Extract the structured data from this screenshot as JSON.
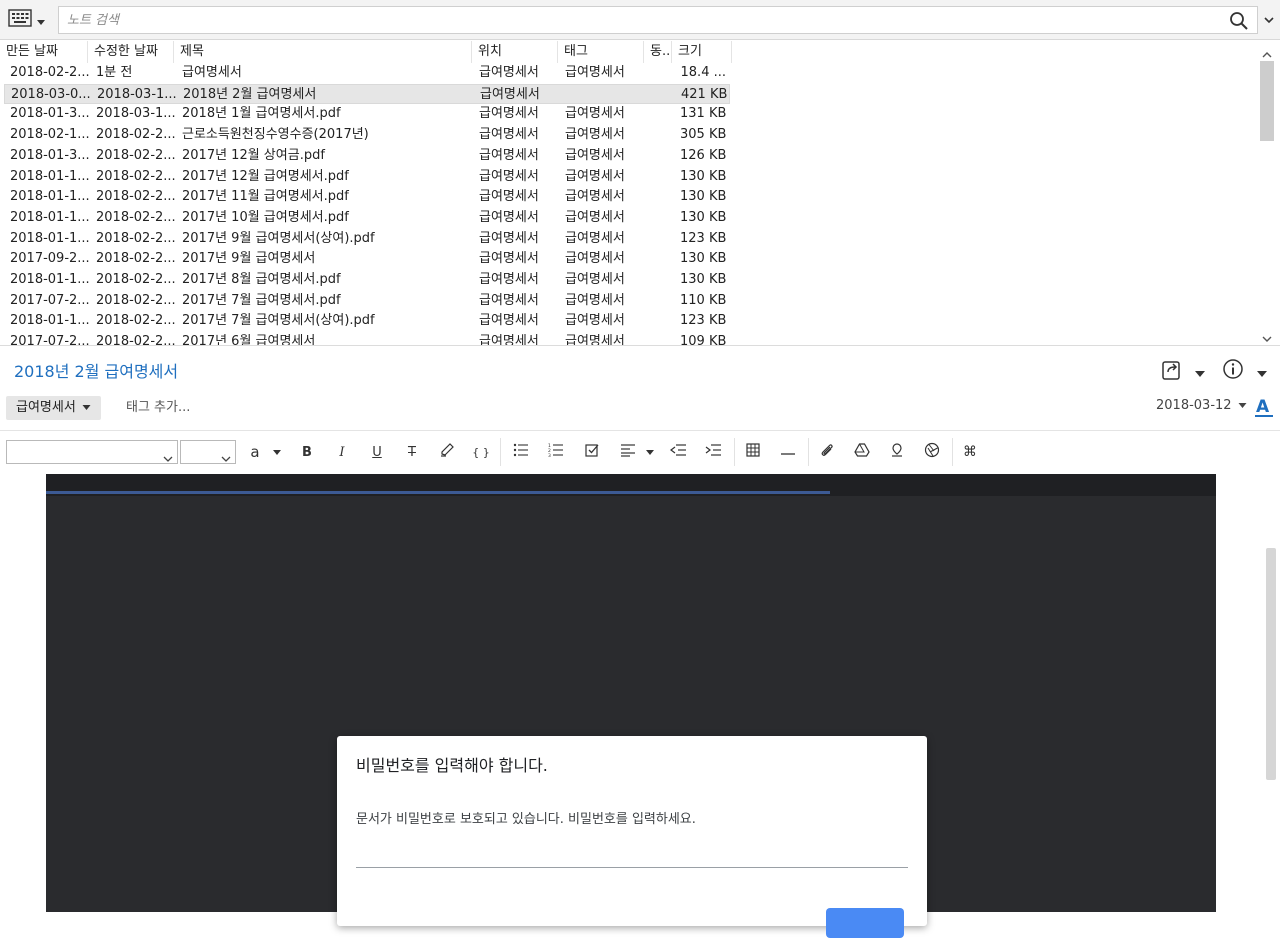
{
  "search": {
    "placeholder": "노트 검색"
  },
  "icons": {
    "view_switch": "keyboard-grid-icon",
    "search": "search-icon",
    "search_options": "chevron-down-icon",
    "share": "share-icon",
    "info": "info-icon",
    "font_style": "font-color-icon"
  },
  "list": {
    "columns": [
      "만든 날짜",
      "수정한 날짜",
      "제목",
      "위치",
      "태그",
      "동...",
      "크기"
    ],
    "rows": [
      {
        "created": "2018-02-2...",
        "modified": "1분 전",
        "title": "급여명세서",
        "location": "급여명세서",
        "tag": "급여명세서",
        "sync": "",
        "size": "18.4 ..."
      },
      {
        "created": "2018-03-0...",
        "modified": "2018-03-1...",
        "title": "2018년 2월 급여명세서",
        "location": "급여명세서",
        "tag": "",
        "sync": "",
        "size": "421 KB"
      },
      {
        "created": "2018-01-3...",
        "modified": "2018-03-1...",
        "title": "2018년 1월 급여명세서.pdf",
        "location": "급여명세서",
        "tag": "급여명세서",
        "sync": "",
        "size": "131 KB"
      },
      {
        "created": "2018-02-1...",
        "modified": "2018-02-2...",
        "title": "근로소득원천징수영수증(2017년)",
        "location": "급여명세서",
        "tag": "급여명세서",
        "sync": "",
        "size": "305 KB"
      },
      {
        "created": "2018-01-3...",
        "modified": "2018-02-2...",
        "title": "2017년 12월 상여금.pdf",
        "location": "급여명세서",
        "tag": "급여명세서",
        "sync": "",
        "size": "126 KB"
      },
      {
        "created": "2018-01-1...",
        "modified": "2018-02-2...",
        "title": "2017년 12월 급여명세서.pdf",
        "location": "급여명세서",
        "tag": "급여명세서",
        "sync": "",
        "size": "130 KB"
      },
      {
        "created": "2018-01-1...",
        "modified": "2018-02-2...",
        "title": "2017년 11월 급여명세서.pdf",
        "location": "급여명세서",
        "tag": "급여명세서",
        "sync": "",
        "size": "130 KB"
      },
      {
        "created": "2018-01-1...",
        "modified": "2018-02-2...",
        "title": "2017년 10월 급여명세서.pdf",
        "location": "급여명세서",
        "tag": "급여명세서",
        "sync": "",
        "size": "130 KB"
      },
      {
        "created": "2018-01-1...",
        "modified": "2018-02-2...",
        "title": "2017년 9월 급여명세서(상여).pdf",
        "location": "급여명세서",
        "tag": "급여명세서",
        "sync": "",
        "size": "123 KB"
      },
      {
        "created": "2017-09-2...",
        "modified": "2018-02-2...",
        "title": "2017년 9월 급여명세서",
        "location": "급여명세서",
        "tag": "급여명세서",
        "sync": "",
        "size": "130 KB"
      },
      {
        "created": "2018-01-1...",
        "modified": "2018-02-2...",
        "title": "2017년 8월 급여명세서.pdf",
        "location": "급여명세서",
        "tag": "급여명세서",
        "sync": "",
        "size": "130 KB"
      },
      {
        "created": "2017-07-2...",
        "modified": "2018-02-2...",
        "title": "2017년 7월 급여명세서.pdf",
        "location": "급여명세서",
        "tag": "급여명세서",
        "sync": "",
        "size": "110 KB"
      },
      {
        "created": "2018-01-1...",
        "modified": "2018-02-2...",
        "title": "2017년 7월 급여명세서(상여).pdf",
        "location": "급여명세서",
        "tag": "급여명세서",
        "sync": "",
        "size": "123 KB"
      },
      {
        "created": "2017-07-2...",
        "modified": "2018-02-2...",
        "title": "2017년 6월 급여명세서",
        "location": "급여명세서",
        "tag": "급여명세서",
        "sync": "",
        "size": "109 KB"
      }
    ],
    "selected_index": 1
  },
  "note": {
    "title": "2018년 2월 급여명세서",
    "notebook": "급여명세서",
    "tag_placeholder": "태그 추가...",
    "date": "2018-03-12"
  },
  "toolbar": {
    "font_family": "",
    "font_size": "",
    "font_color_label": "a",
    "bold": "B",
    "italic": "I",
    "underline": "U",
    "strike": "T",
    "code": "{ }",
    "shortcut": "⌘"
  },
  "pdf": {
    "progress": 0.67,
    "dialog": {
      "title": "비밀번호를 입력해야 합니다.",
      "message": "문서가 비밀번호로 보호되고 있습니다. 비밀번호를 입력하세요.",
      "input_value": ""
    }
  },
  "colors": {
    "accent": "#1f6fbf",
    "pdf_bg": "#2a2b2e",
    "pdf_topbar": "#1f2023",
    "progress": "#3c5a94",
    "primary_button": "#4a8af4"
  }
}
